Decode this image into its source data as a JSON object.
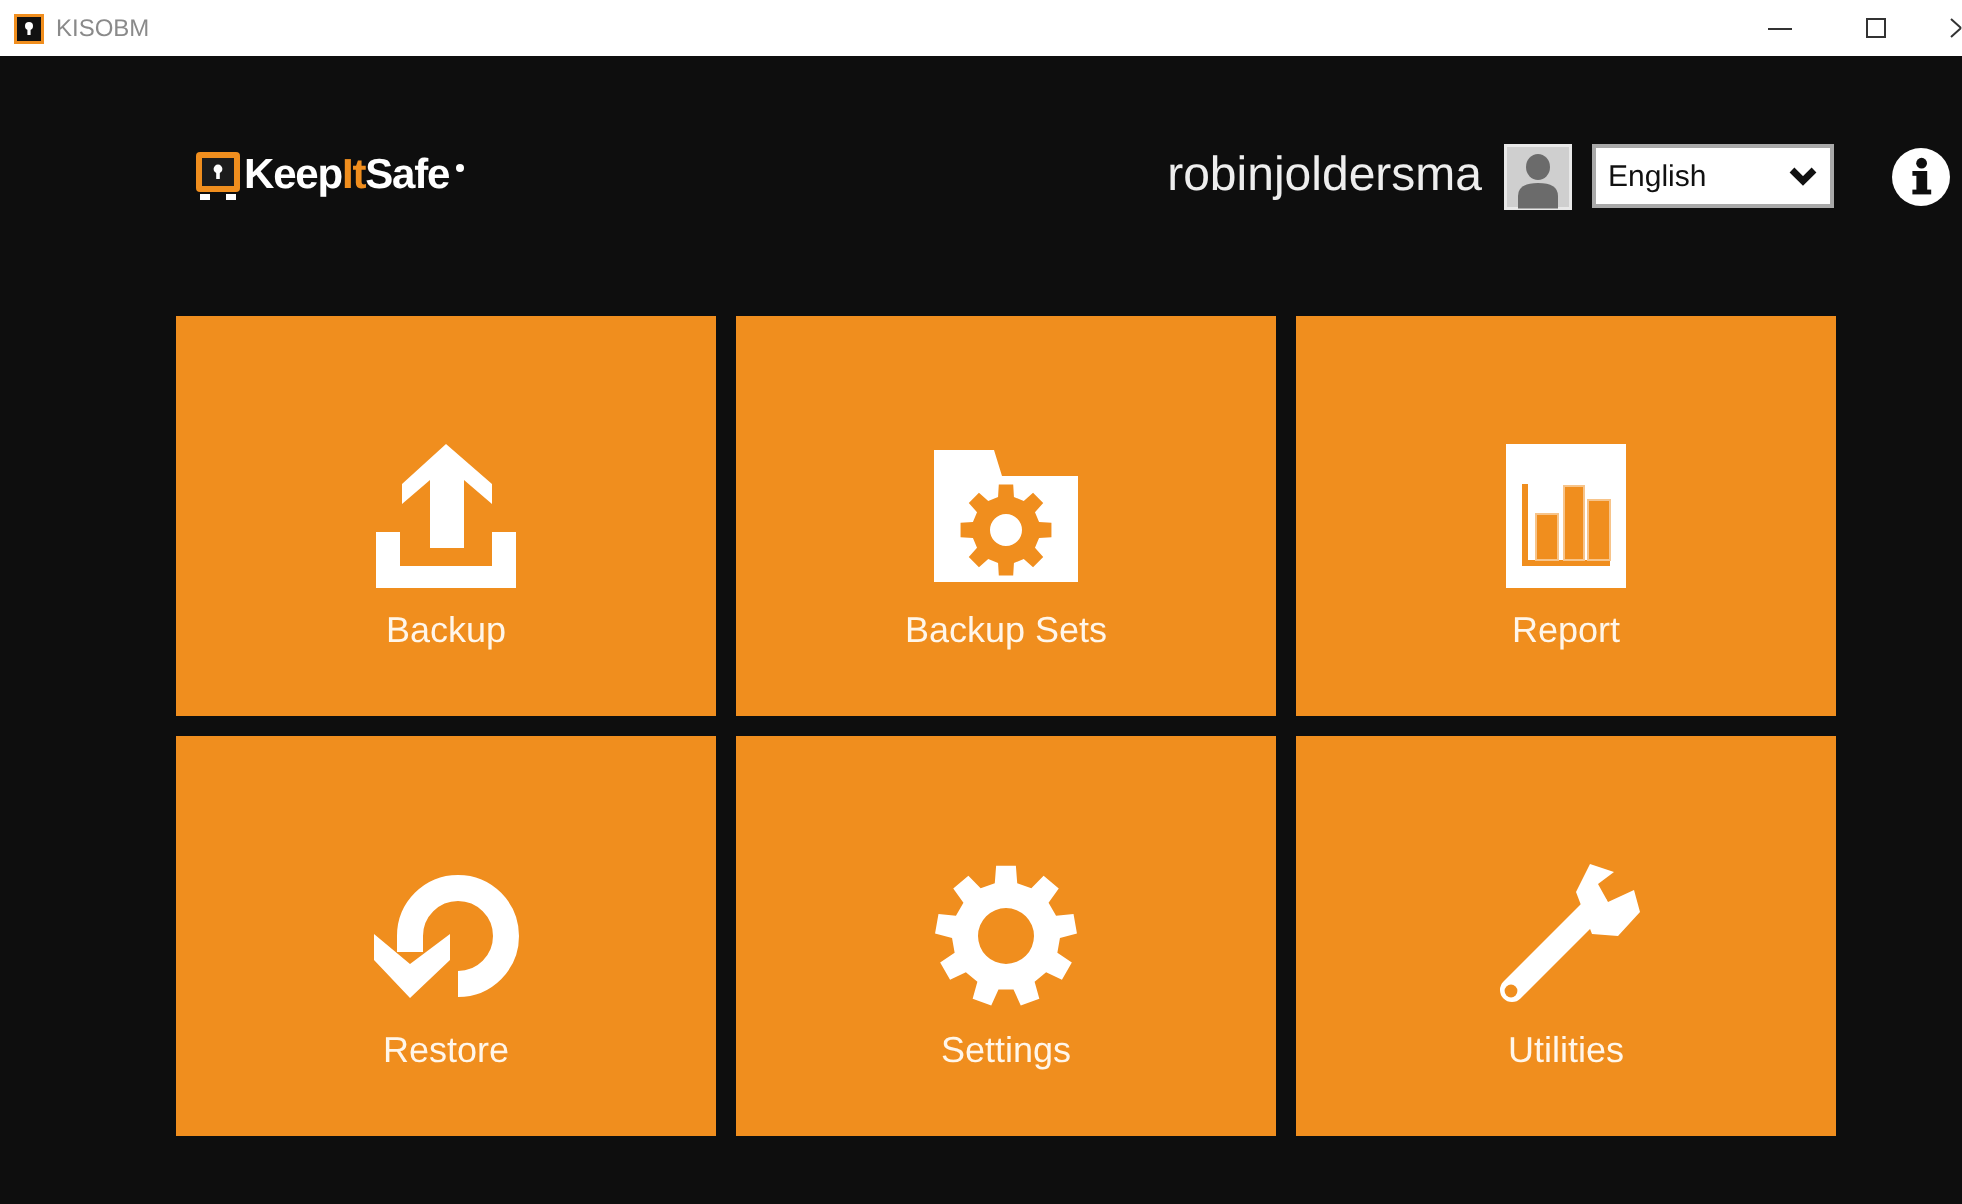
{
  "window": {
    "title": "KISOBM"
  },
  "header": {
    "logo": {
      "parts": [
        {
          "text": "Keep",
          "accent": false
        },
        {
          "text": "It",
          "accent": true
        },
        {
          "text": "Safe",
          "accent": false
        }
      ]
    },
    "username": "robinjoldersma",
    "language_select": {
      "value": "English"
    }
  },
  "tiles": [
    {
      "label": "Backup",
      "kind": "upload"
    },
    {
      "label": "Backup Sets",
      "kind": "folder-gear"
    },
    {
      "label": "Report",
      "kind": "chart"
    },
    {
      "label": "Restore",
      "kind": "restore"
    },
    {
      "label": "Settings",
      "kind": "gear"
    },
    {
      "label": "Utilities",
      "kind": "wrench"
    }
  ]
}
